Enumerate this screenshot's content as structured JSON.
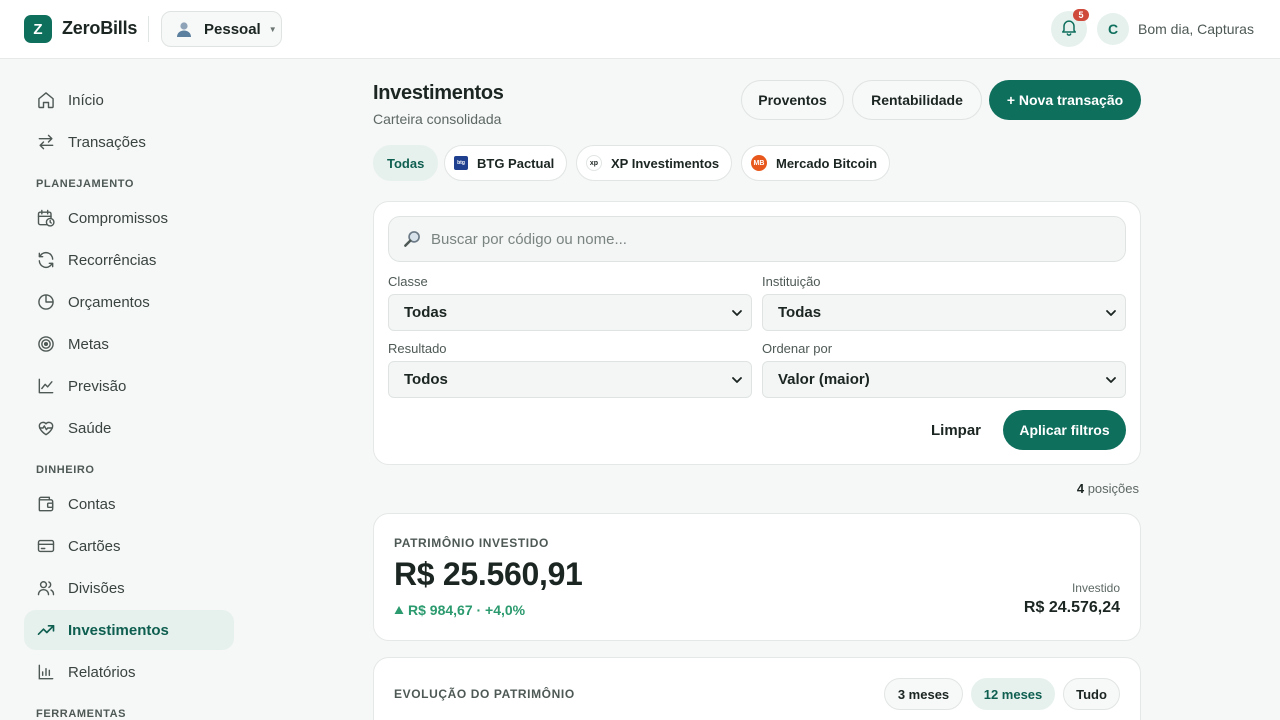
{
  "app": {
    "logo_letter": "Z",
    "name": "ZeroBills"
  },
  "profile": {
    "label": "Pessoal"
  },
  "notifications": {
    "count": "5"
  },
  "user": {
    "initial": "C",
    "greeting": "Bom dia, Capturas"
  },
  "sidebar": {
    "items_top": [
      {
        "label": "Início",
        "icon": "home-icon"
      },
      {
        "label": "Transações",
        "icon": "arrows-icon"
      }
    ],
    "section_planejamento": "PLANEJAMENTO",
    "items_planejamento": [
      {
        "label": "Compromissos",
        "icon": "calendar-clock-icon"
      },
      {
        "label": "Recorrências",
        "icon": "refresh-icon"
      },
      {
        "label": "Orçamentos",
        "icon": "pie-icon"
      },
      {
        "label": "Metas",
        "icon": "target-icon"
      },
      {
        "label": "Previsão",
        "icon": "line-chart-icon"
      },
      {
        "label": "Saúde",
        "icon": "heart-pulse-icon"
      }
    ],
    "section_dinheiro": "DINHEIRO",
    "items_dinheiro": [
      {
        "label": "Contas",
        "icon": "wallet-icon"
      },
      {
        "label": "Cartões",
        "icon": "credit-card-icon"
      },
      {
        "label": "Divisões",
        "icon": "users-icon"
      },
      {
        "label": "Investimentos",
        "icon": "trending-up-icon",
        "active": true
      },
      {
        "label": "Relatórios",
        "icon": "bar-chart-icon"
      }
    ],
    "section_ferramentas": "FERRAMENTAS"
  },
  "header": {
    "title": "Investimentos",
    "subtitle": "Carteira consolidada",
    "btn_proventos": "Proventos",
    "btn_rentabilidade": "Rentabilidade",
    "btn_nova": "+ Nova transação"
  },
  "institutions": [
    {
      "label": "Todas",
      "active": true
    },
    {
      "label": "BTG Pactual",
      "logo_text": "btg"
    },
    {
      "label": "XP Investimentos",
      "logo_text": "xp"
    },
    {
      "label": "Mercado Bitcoin",
      "logo_text": "MB"
    }
  ],
  "filters": {
    "search_placeholder": "Buscar por código ou nome...",
    "classe_label": "Classe",
    "classe_value": "Todas",
    "instituicao_label": "Instituição",
    "instituicao_value": "Todas",
    "resultado_label": "Resultado",
    "resultado_value": "Todos",
    "ordenar_label": "Ordenar por",
    "ordenar_value": "Valor (maior)",
    "limpar": "Limpar",
    "aplicar": "Aplicar filtros"
  },
  "positions": {
    "count": "4",
    "label": "posições"
  },
  "patrimonio": {
    "kicker": "PATRIMÔNIO INVESTIDO",
    "value": "R$ 25.560,91",
    "delta": "R$ 984,67 · +4,0%",
    "invested_label": "Investido",
    "invested_value": "R$ 24.576,24"
  },
  "evolucao": {
    "kicker": "EVOLUÇÃO DO PATRIMÔNIO",
    "ranges": [
      "3 meses",
      "12 meses",
      "Tudo"
    ],
    "active_range": "12 meses"
  },
  "colors": {
    "brand": "#0f6f5d",
    "accent_soft": "#e6f1ee",
    "positive": "#2b9a6e",
    "badge": "#d04a3c"
  }
}
